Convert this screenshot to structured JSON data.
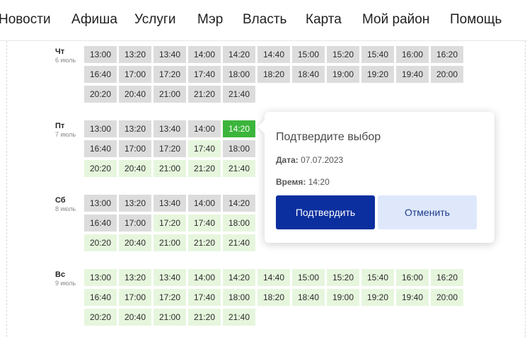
{
  "nav": {
    "items": [
      "Новости",
      "Афиша",
      "Услуги",
      "Мэр",
      "Власть",
      "Карта",
      "Мой район",
      "Помощь"
    ]
  },
  "days": [
    {
      "name": "Чт",
      "date": "6 июль",
      "slots": [
        {
          "t": "13:00",
          "s": "busy"
        },
        {
          "t": "13:20",
          "s": "busy"
        },
        {
          "t": "13:40",
          "s": "busy"
        },
        {
          "t": "14:00",
          "s": "busy"
        },
        {
          "t": "14:20",
          "s": "busy"
        },
        {
          "t": "14:40",
          "s": "busy"
        },
        {
          "t": "15:00",
          "s": "busy"
        },
        {
          "t": "15:20",
          "s": "busy"
        },
        {
          "t": "15:40",
          "s": "busy"
        },
        {
          "t": "16:00",
          "s": "busy"
        },
        {
          "t": "16:20",
          "s": "busy"
        },
        {
          "t": "16:40",
          "s": "busy"
        },
        {
          "t": "17:00",
          "s": "busy"
        },
        {
          "t": "17:20",
          "s": "busy"
        },
        {
          "t": "17:40",
          "s": "busy"
        },
        {
          "t": "18:00",
          "s": "busy"
        },
        {
          "t": "18:20",
          "s": "busy"
        },
        {
          "t": "18:40",
          "s": "busy"
        },
        {
          "t": "19:00",
          "s": "busy"
        },
        {
          "t": "19:20",
          "s": "busy"
        },
        {
          "t": "19:40",
          "s": "busy"
        },
        {
          "t": "20:00",
          "s": "busy"
        },
        {
          "t": "20:20",
          "s": "busy"
        },
        {
          "t": "20:40",
          "s": "busy"
        },
        {
          "t": "21:00",
          "s": "busy"
        },
        {
          "t": "21:20",
          "s": "busy"
        },
        {
          "t": "21:40",
          "s": "busy"
        }
      ]
    },
    {
      "name": "Пт",
      "date": "7 июль",
      "slots": [
        {
          "t": "13:00",
          "s": "busy"
        },
        {
          "t": "13:20",
          "s": "busy"
        },
        {
          "t": "13:40",
          "s": "busy"
        },
        {
          "t": "14:00",
          "s": "busy"
        },
        {
          "t": "14:20",
          "s": "selected"
        },
        {
          "t": "16:40",
          "s": "busy"
        },
        {
          "t": "17:00",
          "s": "busy"
        },
        {
          "t": "17:20",
          "s": "busy"
        },
        {
          "t": "17:40",
          "s": "free"
        },
        {
          "t": "18:00",
          "s": "busy"
        },
        {
          "t": "20:20",
          "s": "free"
        },
        {
          "t": "20:40",
          "s": "free"
        },
        {
          "t": "21:00",
          "s": "free"
        },
        {
          "t": "21:20",
          "s": "free"
        },
        {
          "t": "21:40",
          "s": "free"
        }
      ]
    },
    {
      "name": "Сб",
      "date": "8 июль",
      "slots": [
        {
          "t": "13:00",
          "s": "busy"
        },
        {
          "t": "13:20",
          "s": "busy"
        },
        {
          "t": "13:40",
          "s": "busy"
        },
        {
          "t": "14:00",
          "s": "busy"
        },
        {
          "t": "14:20",
          "s": "busy"
        },
        {
          "t": "16:40",
          "s": "busy"
        },
        {
          "t": "17:00",
          "s": "busy"
        },
        {
          "t": "17:20",
          "s": "free"
        },
        {
          "t": "17:40",
          "s": "free"
        },
        {
          "t": "18:00",
          "s": "free"
        },
        {
          "t": "20:20",
          "s": "free"
        },
        {
          "t": "20:40",
          "s": "free"
        },
        {
          "t": "21:00",
          "s": "free"
        },
        {
          "t": "21:20",
          "s": "free"
        },
        {
          "t": "21:40",
          "s": "free"
        }
      ]
    },
    {
      "name": "Вс",
      "date": "9 июль",
      "slots": [
        {
          "t": "13:00",
          "s": "free"
        },
        {
          "t": "13:20",
          "s": "free"
        },
        {
          "t": "13:40",
          "s": "free"
        },
        {
          "t": "14:00",
          "s": "free"
        },
        {
          "t": "14:20",
          "s": "free"
        },
        {
          "t": "14:40",
          "s": "free"
        },
        {
          "t": "15:00",
          "s": "free"
        },
        {
          "t": "15:20",
          "s": "free"
        },
        {
          "t": "15:40",
          "s": "free"
        },
        {
          "t": "16:00",
          "s": "free"
        },
        {
          "t": "16:20",
          "s": "free"
        },
        {
          "t": "16:40",
          "s": "free"
        },
        {
          "t": "17:00",
          "s": "free"
        },
        {
          "t": "17:20",
          "s": "free"
        },
        {
          "t": "17:40",
          "s": "free"
        },
        {
          "t": "18:00",
          "s": "free"
        },
        {
          "t": "18:20",
          "s": "free"
        },
        {
          "t": "18:40",
          "s": "free"
        },
        {
          "t": "19:00",
          "s": "free"
        },
        {
          "t": "19:20",
          "s": "free"
        },
        {
          "t": "19:40",
          "s": "free"
        },
        {
          "t": "20:00",
          "s": "free"
        },
        {
          "t": "20:20",
          "s": "free"
        },
        {
          "t": "20:40",
          "s": "free"
        },
        {
          "t": "21:00",
          "s": "free"
        },
        {
          "t": "21:20",
          "s": "free"
        },
        {
          "t": "21:40",
          "s": "free"
        }
      ]
    }
  ],
  "popover": {
    "title": "Подтвердите выбор",
    "date_label": "Дата:",
    "date_value": "07.07.2023",
    "time_label": "Время:",
    "time_value": "14:20",
    "confirm_label": "Подтвердить",
    "cancel_label": "Отменить"
  },
  "colors": {
    "busy": "#dcdcdc",
    "free": "#e6f6dd",
    "selected": "#3cb53c",
    "confirm_button": "#0b2f9f",
    "cancel_button": "#dfe8fb"
  }
}
